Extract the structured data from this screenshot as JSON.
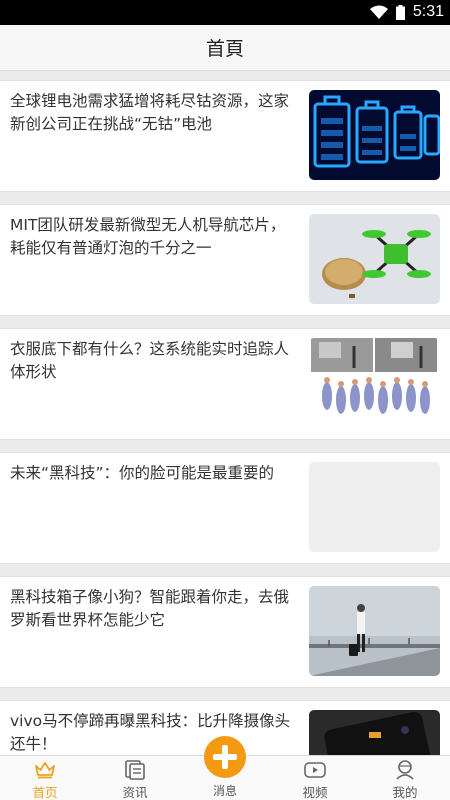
{
  "status": {
    "time": "5:31",
    "wifi_icon": "wifi-icon",
    "battery_icon": "battery-icon"
  },
  "header": {
    "title": "首頁"
  },
  "feed": {
    "items": [
      {
        "headline": "全球锂电池需求猛增将耗尽钴资源，这家新创公司正在挑战“无钴”电池",
        "thumb_icon": "battery-image"
      },
      {
        "headline": "MIT团队研发最新微型无人机导航芯片，耗能仅有普通灯泡的千分之一",
        "thumb_icon": "drone-image"
      },
      {
        "headline": "衣服底下都有什么？这系统能实时追踪人体形状",
        "thumb_icon": "body-tracking-image"
      },
      {
        "headline": "未来“黑科技”：你的脸可能是最重要的",
        "thumb_icon": "placeholder-image"
      },
      {
        "headline": "黑科技箱子像小狗？智能跟着你走，去俄罗斯看世界杯怎能少它",
        "thumb_icon": "luggage-image"
      },
      {
        "headline": "vivo马不停蹄再曝黑科技：比升降摄像头还牛！",
        "thumb_icon": "phone-image"
      }
    ]
  },
  "tabbar": {
    "tabs": [
      {
        "label": "首页",
        "icon": "crown-icon"
      },
      {
        "label": "资讯",
        "icon": "news-icon"
      },
      {
        "label": "消息",
        "icon": "plus-icon"
      },
      {
        "label": "视频",
        "icon": "video-icon"
      },
      {
        "label": "我的",
        "icon": "user-icon"
      }
    ],
    "active_color": "#f0a020",
    "center_color": "#f39a12"
  }
}
